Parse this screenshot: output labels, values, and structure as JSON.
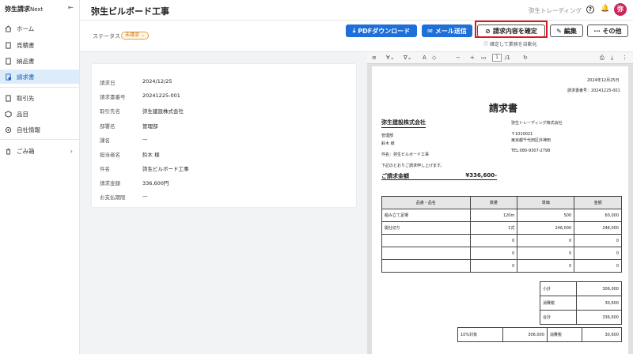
{
  "sidebar": {
    "logo": "弥生請求",
    "logo_sub": "Next",
    "items": [
      {
        "label": "ホーム"
      },
      {
        "label": "見積書"
      },
      {
        "label": "納品書"
      },
      {
        "label": "請求書"
      },
      {
        "label": "取引先"
      },
      {
        "label": "品目"
      },
      {
        "label": "自社情報"
      },
      {
        "label": "ごみ箱"
      }
    ]
  },
  "header": {
    "title": "弥生ビルボード工事",
    "company": "弥生トレーディング",
    "avatar": "弥"
  },
  "toolbar": {
    "status_label": "ステータス",
    "status_value": "未請求",
    "pdf_label": "PDFダウンロード",
    "mail_label": "メール送信",
    "confirm_label": "請求内容を確定",
    "edit_label": "編集",
    "more_label": "その他",
    "hint": "確定して業務を自動化"
  },
  "info": [
    {
      "key": "請求日",
      "value": "2024/12/25"
    },
    {
      "key": "請求書番号",
      "value": "20241225-001"
    },
    {
      "key": "取引先名",
      "value": "弥生建設株式会社"
    },
    {
      "key": "部署名",
      "value": "管理部"
    },
    {
      "key": "課名",
      "value": "—"
    },
    {
      "key": "担当者名",
      "value": "鈴木 様"
    },
    {
      "key": "件名",
      "value": "弥生ビルボード工事"
    },
    {
      "key": "請求金額",
      "value": "336,600円"
    },
    {
      "key": "お支払期限",
      "value": "—"
    }
  ],
  "viewer": {
    "page_current": "1",
    "page_total": "/1"
  },
  "invoice": {
    "date": "2024年12月25日",
    "number": "請求書番号：20241225-001",
    "title": "請求書",
    "client": "弥生建設株式会社",
    "dept": "管理部",
    "person": "鈴木 様",
    "subject": "件名：弥生ビルボード工事",
    "note": "下記のとおりご請求申し上げます。",
    "total_label": "ご請求金額",
    "total_value": "¥336,600-",
    "issuer": "弥生トレーディング株式会社",
    "zip": "〒1010021",
    "address": "東京都千代田区外神田",
    "tel": "TEL:080-9307-2798",
    "columns": [
      "品番・品名",
      "数量",
      "単価",
      "金額"
    ],
    "rows": [
      [
        "組み立て足場",
        "120m",
        "500",
        "60,000"
      ],
      [
        "開仕切り",
        "1式",
        "246,000",
        "246,000"
      ],
      [
        "",
        "0",
        "0",
        "0"
      ],
      [
        "",
        "0",
        "0",
        "0"
      ],
      [
        "",
        "0",
        "0",
        "0"
      ]
    ],
    "summary": [
      {
        "label": "小計",
        "value": "306,000"
      },
      {
        "label": "消費税",
        "value": "30,600"
      },
      {
        "label": "合計",
        "value": "336,600"
      }
    ],
    "tax_row": {
      "rate": "10%対象",
      "base": "306,000",
      "label": "消費税",
      "value": "30,600"
    }
  }
}
